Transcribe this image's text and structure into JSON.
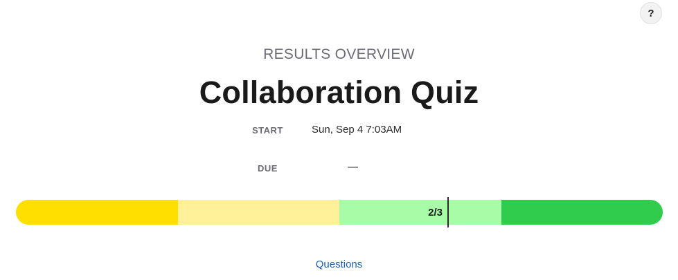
{
  "help_button": {
    "label": "?",
    "icon": "help-icon"
  },
  "header": {
    "overline": "RESULTS OVERVIEW",
    "title": "Collaboration Quiz"
  },
  "meta": {
    "start_label": "START",
    "start_value": "Sun, Sep 4 7:03AM",
    "due_label": "DUE",
    "due_value": "—"
  },
  "score_bar": {
    "score_label": "2/3",
    "score_fraction": 0.6667,
    "segments": [
      {
        "name": "range-1",
        "color": "#ffdf00"
      },
      {
        "name": "range-2",
        "color": "#fff19a"
      },
      {
        "name": "range-3",
        "color": "#a8fca8"
      },
      {
        "name": "range-4",
        "color": "#30cc4e"
      }
    ]
  },
  "links": {
    "questions": "Questions"
  },
  "colors": {
    "link": "#1a5fb4",
    "muted_text": "#6b6b75"
  }
}
